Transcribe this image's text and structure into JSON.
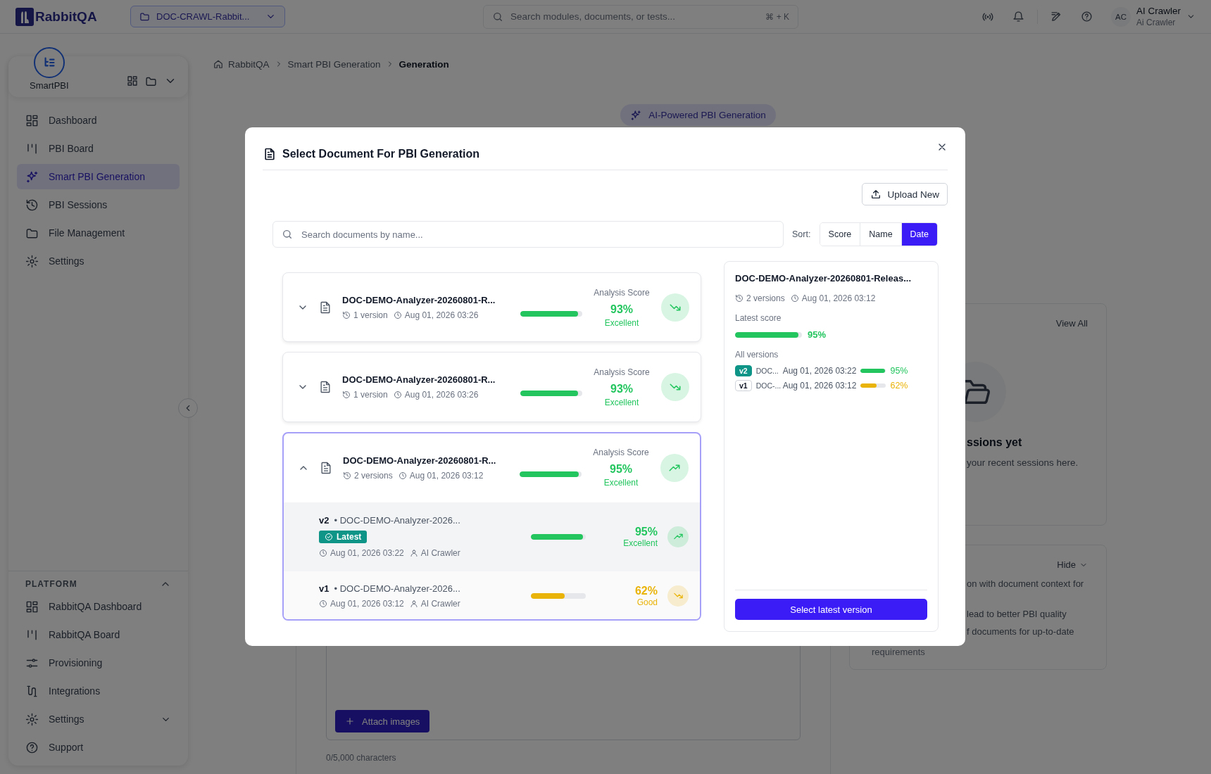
{
  "top_bar": {
    "logo": "RabbitQA",
    "project": "DOC-CRAWL-Rabbit...",
    "search_placeholder": "Search modules, documents, or tests...",
    "shortcut": "⌘ + K",
    "avatar": "AC",
    "user_name": "AI Crawler",
    "user_role": "Ai Crawler"
  },
  "sidebar": {
    "app": "SmartPBI",
    "items": [
      {
        "label": "Dashboard",
        "kind": "grid",
        "selected": false
      },
      {
        "label": "PBI Board",
        "kind": "board",
        "selected": false
      },
      {
        "label": "Smart PBI Generation",
        "kind": "sparkle",
        "selected": true
      },
      {
        "label": "PBI Sessions",
        "kind": "history",
        "selected": false
      },
      {
        "label": "File Management",
        "kind": "folder",
        "selected": false
      },
      {
        "label": "Settings",
        "kind": "gear",
        "selected": false
      }
    ],
    "platform": {
      "title": "PLATFORM",
      "expanded": true,
      "items": [
        {
          "label": "RabbitQA Dashboard",
          "kind": "grid",
          "selected": false
        },
        {
          "label": "RabbitQA Board",
          "kind": "board",
          "selected": false
        },
        {
          "label": "Provisioning",
          "kind": "sliders",
          "selected": false
        },
        {
          "label": "Integrations",
          "kind": "route",
          "selected": false
        },
        {
          "label": "Settings",
          "kind": "gear_group",
          "selected": false
        },
        {
          "label": "Support",
          "kind": "help",
          "selected": false
        }
      ]
    }
  },
  "breadcrumb": [
    "RabbitQA",
    "Smart PBI Generation",
    "Generation"
  ],
  "background": {
    "badge": "AI-Powered PBI Generation",
    "editor": {
      "button": "Attach images",
      "counter": "0/5,000 characters"
    },
    "sessions_card": {
      "link": "View All",
      "title": "ssions yet",
      "text": "your recent sessions here."
    },
    "tips_card": {
      "toggle": "Hide",
      "lines": [
        "on with document context for",
        "lead to better PBI quality",
        "f documents for up-to-date",
        "requirements"
      ]
    }
  },
  "modal": {
    "title": "Select Document For PBI Generation",
    "upload": "Upload New",
    "search_placeholder": "Search documents by name...",
    "sort_label": "Sort:",
    "sort_options": [
      {
        "label": "Score",
        "selected": false
      },
      {
        "label": "Name",
        "selected": false
      },
      {
        "label": "Date",
        "selected": true
      }
    ],
    "documents": [
      {
        "title": "DOC-DEMO-Analyzer-20260801-R...",
        "versions": "1 version",
        "date": "Aug 01, 2026 03:26",
        "score_label": "Analysis Score",
        "level": 0.93,
        "score": "93%",
        "grade": "Excellent",
        "color": "#22c55e",
        "kind": "falling",
        "expanded": false,
        "selected": false
      },
      {
        "title": "DOC-DEMO-Analyzer-20260801-R...",
        "versions": "1 version",
        "date": "Aug 01, 2026 03:26",
        "score_label": "Analysis Score",
        "level": 0.93,
        "score": "93%",
        "grade": "Excellent",
        "color": "#22c55e",
        "kind": "falling",
        "expanded": false,
        "selected": false
      },
      {
        "title": "DOC-DEMO-Analyzer-20260801-R...",
        "versions": "2 versions",
        "date": "Aug 01, 2026 03:12",
        "score_label": "Analysis Score",
        "level": 0.95,
        "score": "95%",
        "grade": "Excellent",
        "color": "#22c55e",
        "kind": "rising",
        "expanded": true,
        "selected": true,
        "children": [
          {
            "tag": "v2",
            "name": "• DOC-DEMO-Analyzer-2026...",
            "badge": "Latest",
            "date": "Aug 01, 2026 03:22",
            "author": "AI Crawler",
            "level": 0.95,
            "score": "95%",
            "grade": "Excellent",
            "color": "#22c55e",
            "kind": "rising"
          },
          {
            "tag": "v1",
            "name": "• DOC-DEMO-Analyzer-2026...",
            "date": "Aug 01, 2026 03:12",
            "author": "AI Crawler",
            "level": 0.62,
            "score": "62%",
            "grade": "Good",
            "color": "#eab308",
            "kind": "falling"
          }
        ]
      }
    ],
    "details": {
      "title": "DOC-DEMO-Analyzer-20260801-Releas...",
      "versions": "2 versions",
      "date": "Aug 01, 2026 03:12",
      "latest_label": "Latest score",
      "level": 0.95,
      "score": "95%",
      "color": "#22c55e",
      "versions_label": "All versions",
      "versions_list": [
        {
          "tag": "v2",
          "latest": true,
          "name": "DOC...",
          "date": "Aug 01, 2026 03:22",
          "level": 0.95,
          "score": "95%",
          "color": "#22c55e"
        },
        {
          "tag": "v1",
          "latest": false,
          "name": "DOC-...",
          "date": "Aug 01, 2026 03:12",
          "level": 0.62,
          "score": "62%",
          "color": "#eab308"
        }
      ],
      "button": "Select latest version"
    }
  }
}
